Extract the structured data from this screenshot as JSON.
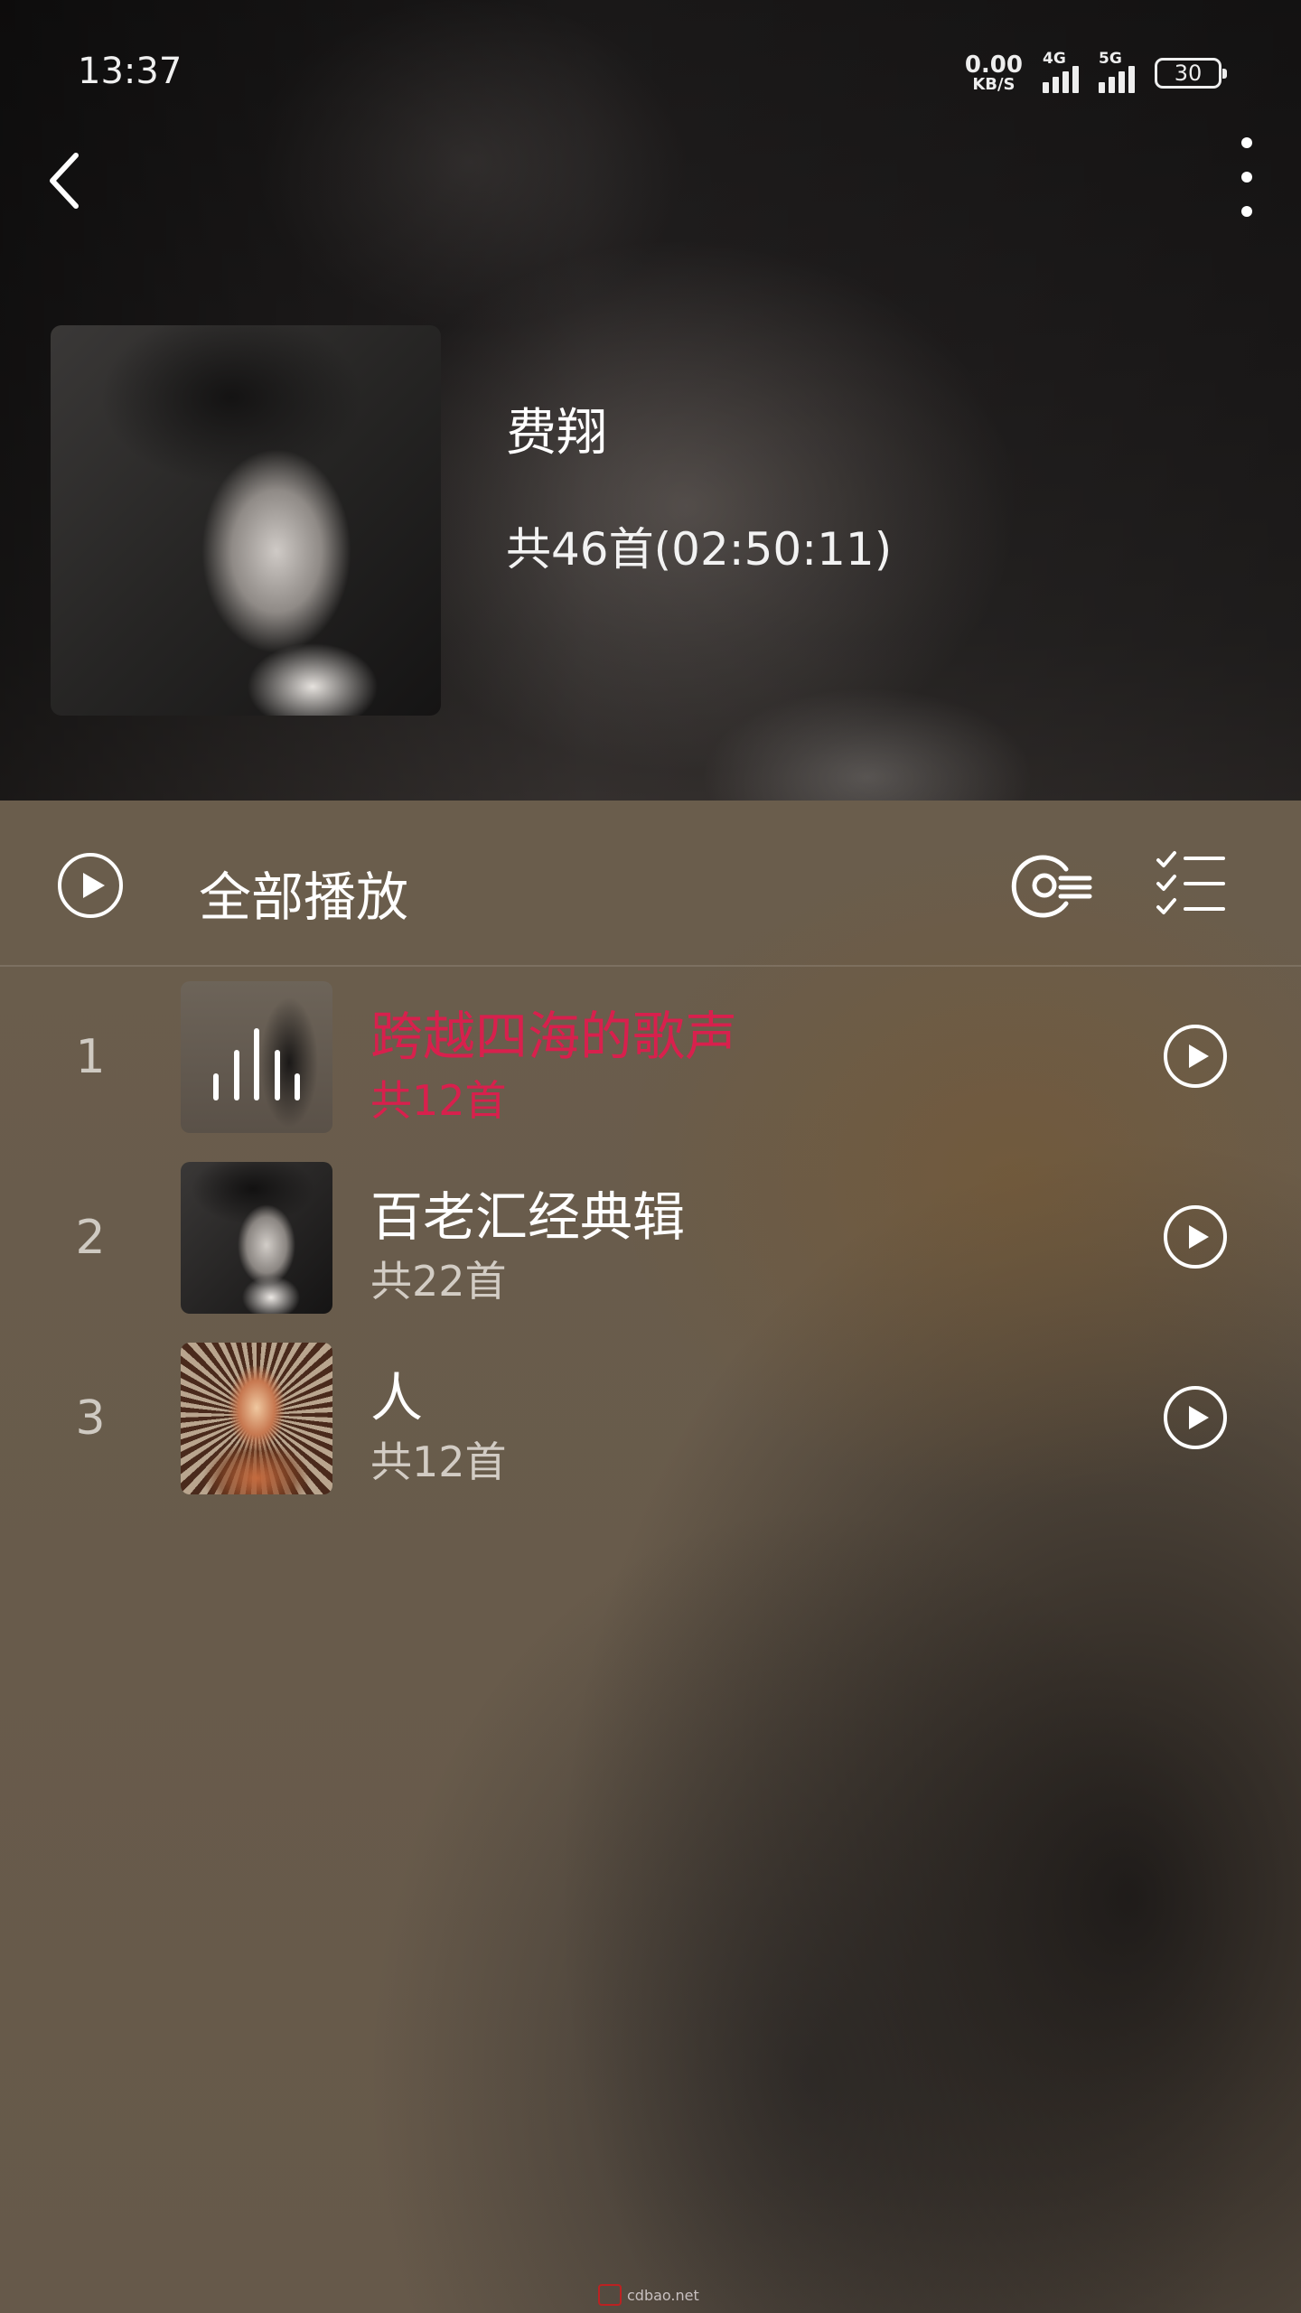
{
  "status_bar": {
    "time": "13:37",
    "net_speed_value": "0.00",
    "net_speed_unit": "KB/S",
    "signal_1_label": "4G",
    "signal_2_label": "5G",
    "battery_level": "30"
  },
  "artist": {
    "name": "费翔",
    "summary": "共46首(02:50:11)"
  },
  "action_bar": {
    "play_all_label": "全部播放"
  },
  "albums": [
    {
      "index": "1",
      "title": "跨越四海的歌声",
      "count": "共12首",
      "playing": true
    },
    {
      "index": "2",
      "title": "百老汇经典辑",
      "count": "共22首",
      "playing": false
    },
    {
      "index": "3",
      "title": "人",
      "count": "共12首",
      "playing": false
    }
  ],
  "colors": {
    "active": "#d8204d",
    "text": "#ffffff",
    "secondary_text": "#d2ccc4"
  },
  "icons": [
    "back-icon",
    "more-icon",
    "play-circle-icon",
    "sort-icon",
    "multi-select-icon",
    "equalizer-icon"
  ],
  "watermark_text": "cdbao.net"
}
